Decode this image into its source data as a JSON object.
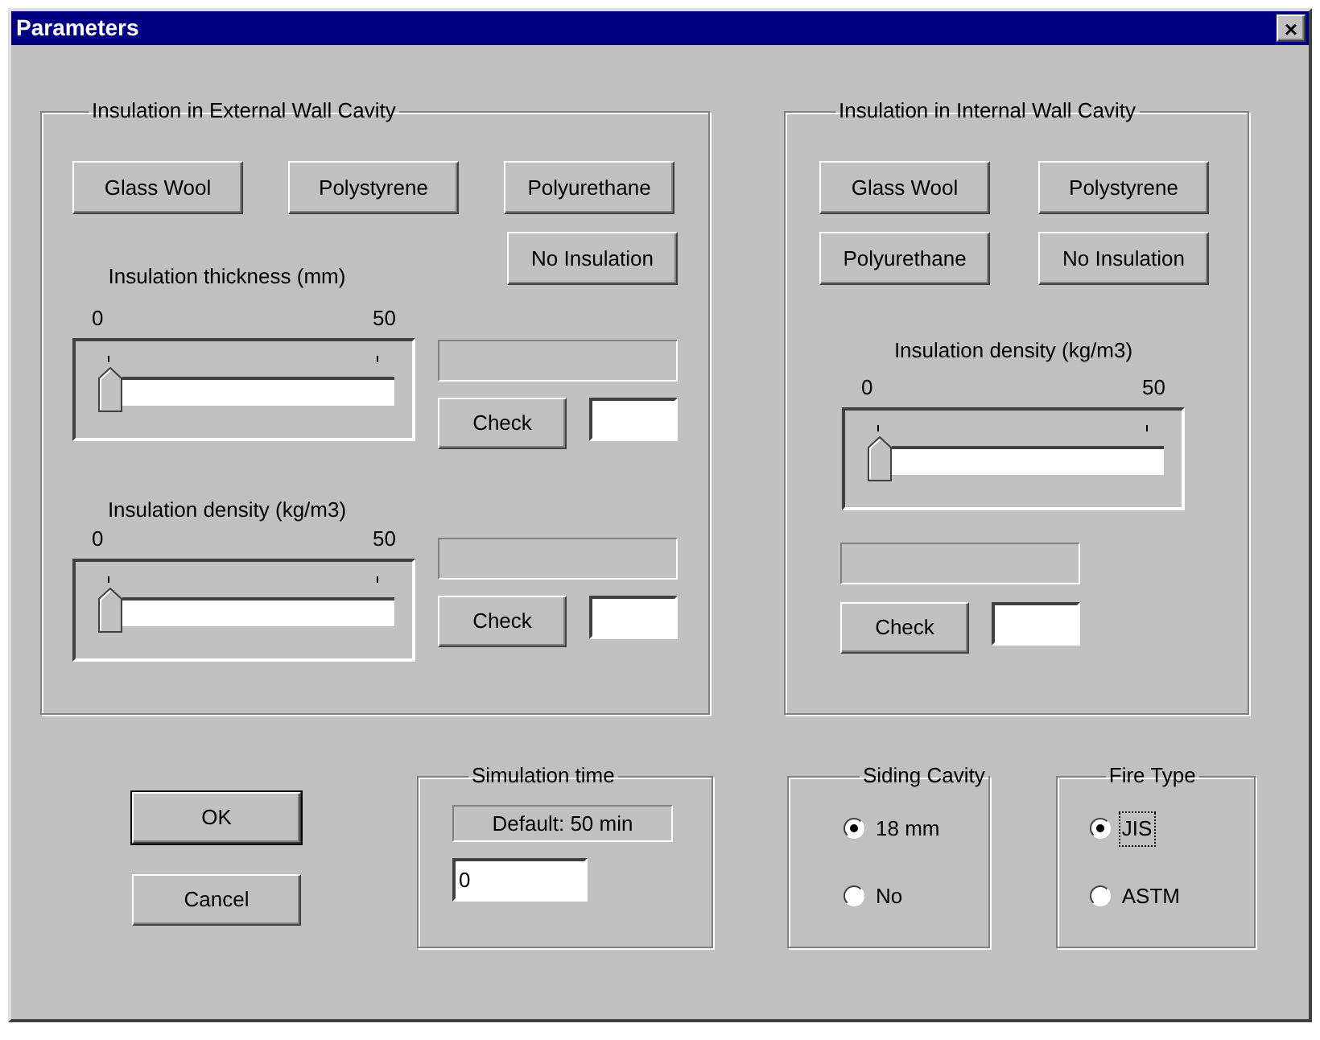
{
  "window": {
    "title": "Parameters",
    "close": "×"
  },
  "external": {
    "title": "Insulation in External Wall Cavity",
    "materials": [
      "Glass Wool",
      "Polystyrene",
      "Polyurethane",
      "No Insulation"
    ],
    "sliders": [
      {
        "label": "Insulation thickness (mm)",
        "min": "0",
        "max": "50",
        "level": 0,
        "check": "Check"
      },
      {
        "label": "Insulation density (kg/m3)",
        "min": "0",
        "max": "50",
        "level": 0,
        "check": "Check"
      }
    ]
  },
  "internal": {
    "title": "Insulation in Internal Wall Cavity",
    "materials": [
      "Glass Wool",
      "Polystyrene",
      "Polyurethane",
      "No Insulation"
    ],
    "slider": {
      "label": "Insulation density (kg/m3)",
      "min": "0",
      "max": "50",
      "level": 0,
      "check": "Check"
    }
  },
  "buttons": [
    {
      "label": "OK",
      "default": true
    },
    {
      "label": "Cancel",
      "default": false
    }
  ],
  "simulation": {
    "title": "Simulation time",
    "default_text": "Default: 50 min",
    "value": "0"
  },
  "siding": {
    "title": "Siding Cavity",
    "options": [
      {
        "label": "18 mm",
        "selected": true,
        "focused": false
      },
      {
        "label": "No",
        "selected": false,
        "focused": false
      }
    ]
  },
  "fire": {
    "title": "Fire Type",
    "options": [
      {
        "label": "JIS",
        "selected": true,
        "focused": true
      },
      {
        "label": "ASTM",
        "selected": false,
        "focused": false
      }
    ]
  }
}
